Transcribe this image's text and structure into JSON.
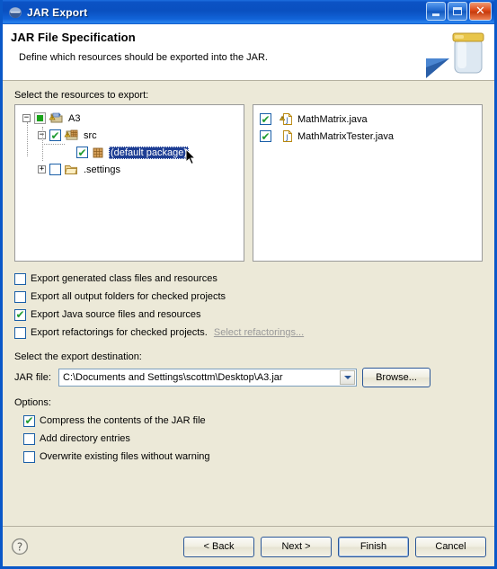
{
  "window": {
    "title": "JAR Export",
    "icon": "eclipse-icon",
    "controls": [
      {
        "name": "minimize-button",
        "glyph": "minimize-icon"
      },
      {
        "name": "maximize-button",
        "glyph": "maximize-icon"
      },
      {
        "name": "close-button",
        "glyph": "close-icon",
        "label": "✕"
      }
    ],
    "accent": "#0a50c0",
    "body_bg": "#ece9d8"
  },
  "header": {
    "title": "JAR File Specification",
    "description": "Define which resources should be exported into the JAR.",
    "art_icon": "jar-banner-icon"
  },
  "resources": {
    "label": "Select the resources to export:",
    "tree": [
      {
        "label": "A3",
        "indent": 0,
        "expander": "−",
        "checkbox": "partial",
        "icon": "project-warning-icon",
        "selected": false
      },
      {
        "label": "src",
        "indent": 1,
        "expander": "−",
        "checkbox": "checked",
        "icon": "source-folder-warning-icon",
        "selected": false
      },
      {
        "label": "(default package)",
        "indent": 2,
        "expander": "",
        "checkbox": "checked",
        "icon": "package-icon",
        "selected": true
      },
      {
        "label": ".settings",
        "indent": 1,
        "expander": "+",
        "checkbox": "unchecked",
        "icon": "folder-icon",
        "selected": false
      }
    ],
    "files": [
      {
        "label": "MathMatrix.java",
        "checkbox": "checked",
        "icon": "java-file-warning-icon"
      },
      {
        "label": "MathMatrixTester.java",
        "checkbox": "checked",
        "icon": "java-file-icon"
      }
    ],
    "selection_bg": "#1e3e94"
  },
  "export_options": [
    {
      "label": "Export generated class files and resources",
      "checked": false
    },
    {
      "label": "Export all output folders for checked projects",
      "checked": false
    },
    {
      "label": "Export Java source files and resources",
      "checked": true
    },
    {
      "label": "Export refactorings for checked projects.",
      "checked": false,
      "link": "Select refactorings..."
    }
  ],
  "destination": {
    "label": "Select the export destination:",
    "field_label": "JAR file:",
    "value": "C:\\Documents and Settings\\scottm\\Desktop\\A3.jar",
    "placeholder": "",
    "browse_label": "Browse...",
    "dropdown_icon": "chevron-down-icon"
  },
  "options": {
    "label": "Options:",
    "items": [
      {
        "label": "Compress the contents of the JAR file",
        "checked": true
      },
      {
        "label": "Add directory entries",
        "checked": false
      },
      {
        "label": "Overwrite existing files without warning",
        "checked": false
      }
    ]
  },
  "footer": {
    "help_icon": "help-icon",
    "buttons": [
      {
        "label": "< Back",
        "name": "back-button",
        "default": false
      },
      {
        "label": "Next >",
        "name": "next-button",
        "default": false
      },
      {
        "label": "Finish",
        "name": "finish-button",
        "default": true
      },
      {
        "label": "Cancel",
        "name": "cancel-button",
        "default": false
      }
    ]
  }
}
